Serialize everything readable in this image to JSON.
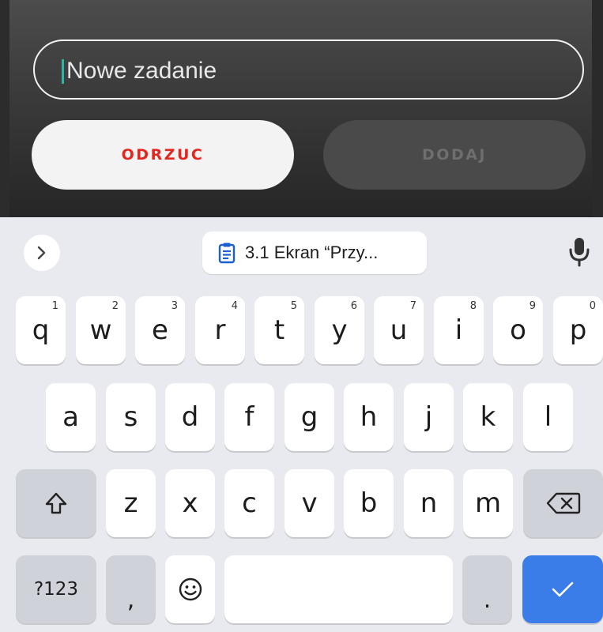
{
  "dialog": {
    "input_placeholder": "Nowe zadanie",
    "reject_label": "ODRZUC",
    "add_label": "DODAJ"
  },
  "keyboard": {
    "clipboard_suggestion": "3.1 Ekran “Przy...",
    "icons": {
      "expand": "chevron-right-icon",
      "clipboard": "clipboard-icon",
      "mic": "mic-icon",
      "shift": "shift-icon",
      "backspace": "backspace-icon",
      "emoji": "emoji-icon",
      "enter": "checkmark-icon"
    },
    "row1": [
      {
        "k": "q",
        "h": "1"
      },
      {
        "k": "w",
        "h": "2"
      },
      {
        "k": "e",
        "h": "3"
      },
      {
        "k": "r",
        "h": "4"
      },
      {
        "k": "t",
        "h": "5"
      },
      {
        "k": "y",
        "h": "6"
      },
      {
        "k": "u",
        "h": "7"
      },
      {
        "k": "i",
        "h": "8"
      },
      {
        "k": "o",
        "h": "9"
      },
      {
        "k": "p",
        "h": "0"
      }
    ],
    "row2": [
      "a",
      "s",
      "d",
      "f",
      "g",
      "h",
      "j",
      "k",
      "l"
    ],
    "row3": [
      "z",
      "x",
      "c",
      "v",
      "b",
      "n",
      "m"
    ],
    "symbols_label": "?123",
    "comma": ",",
    "period": "."
  },
  "colors": {
    "reject_text": "#e3261f",
    "cursor": "#2bb6a3",
    "enter_key": "#3b7de8",
    "keyboard_bg": "#e9eaef"
  }
}
